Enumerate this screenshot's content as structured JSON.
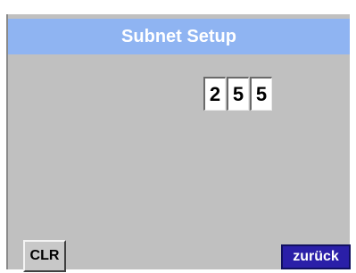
{
  "header": {
    "title": "Subnet Setup"
  },
  "subnet_octet": {
    "digits": [
      "2",
      "5",
      "5"
    ]
  },
  "buttons": {
    "clear_label": "CLR",
    "back_label": "zurück"
  },
  "colors": {
    "title_bar": "#8fb4f2",
    "panel_background": "#c0c0c0",
    "back_button": "#2a1fa8"
  }
}
